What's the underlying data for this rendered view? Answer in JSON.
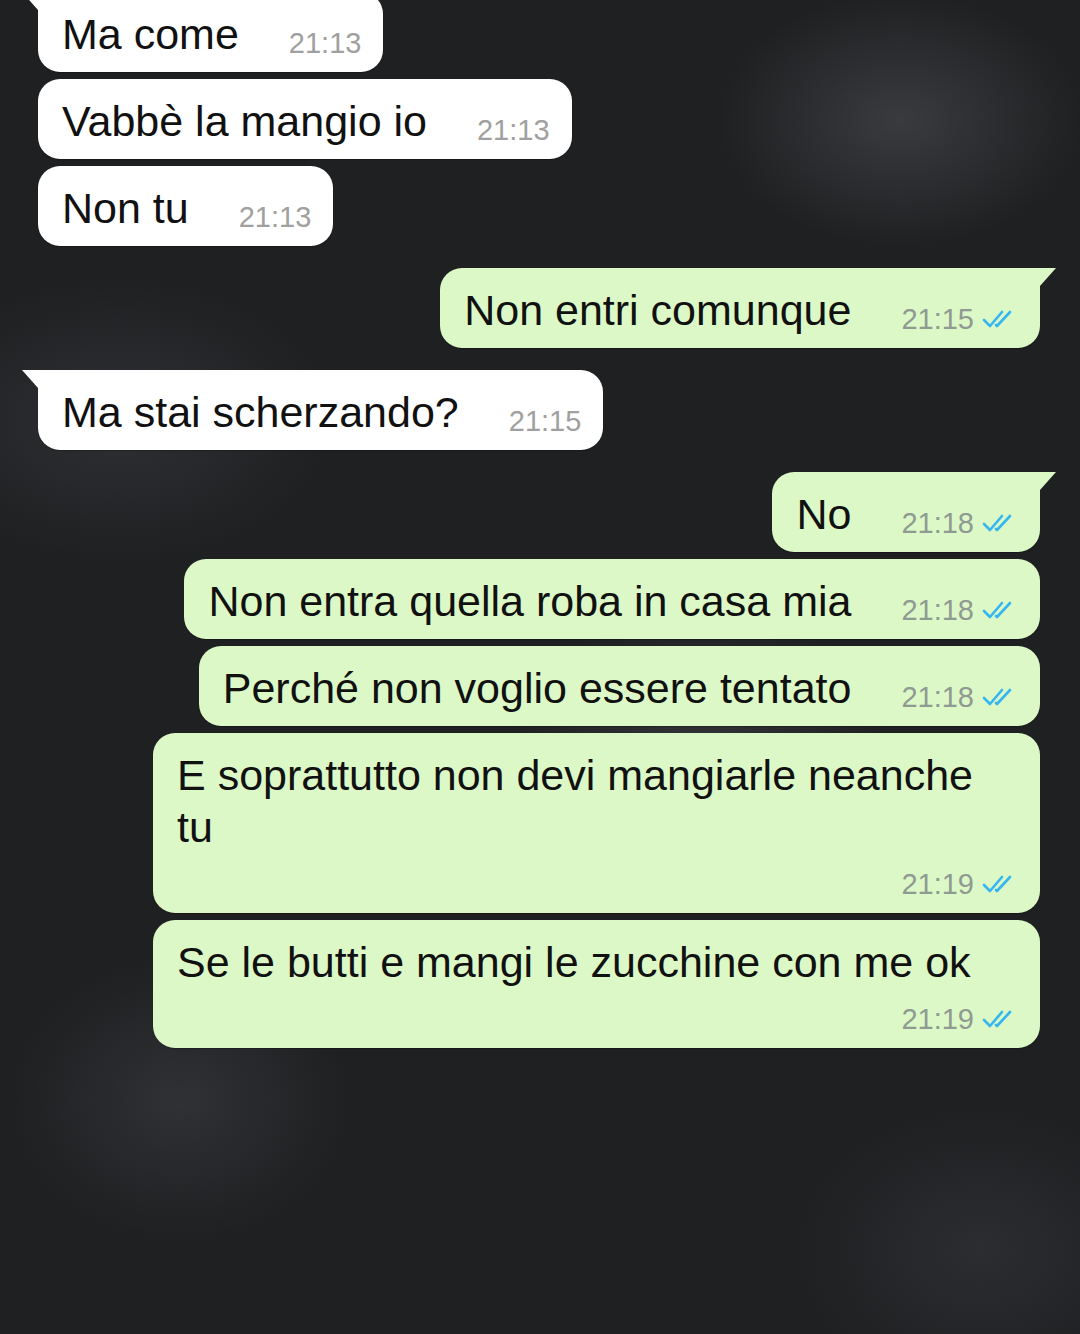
{
  "messages": [
    {
      "text": "Ma come",
      "time": "21:13",
      "outgoing": false
    },
    {
      "text": "Vabbè la mangio io",
      "time": "21:13",
      "outgoing": false
    },
    {
      "text": "Non tu",
      "time": "21:13",
      "outgoing": false
    },
    {
      "text": "Non entri comunque",
      "time": "21:15",
      "outgoing": true,
      "read": true
    },
    {
      "text": "Ma stai scherzando?",
      "time": "21:15",
      "outgoing": false
    },
    {
      "text": "No",
      "time": "21:18",
      "outgoing": true,
      "read": true
    },
    {
      "text": "Non entra quella roba in casa mia",
      "time": "21:18",
      "outgoing": true,
      "read": true
    },
    {
      "text": "Perché non voglio essere tentato",
      "time": "21:18",
      "outgoing": true,
      "read": true
    },
    {
      "text": "E soprattutto non devi mangiarle neanche tu",
      "time": "21:19",
      "outgoing": true,
      "read": true
    },
    {
      "text": "Se le butti e mangi le zucchine con me ok",
      "time": "21:19",
      "outgoing": true,
      "read": true
    }
  ]
}
